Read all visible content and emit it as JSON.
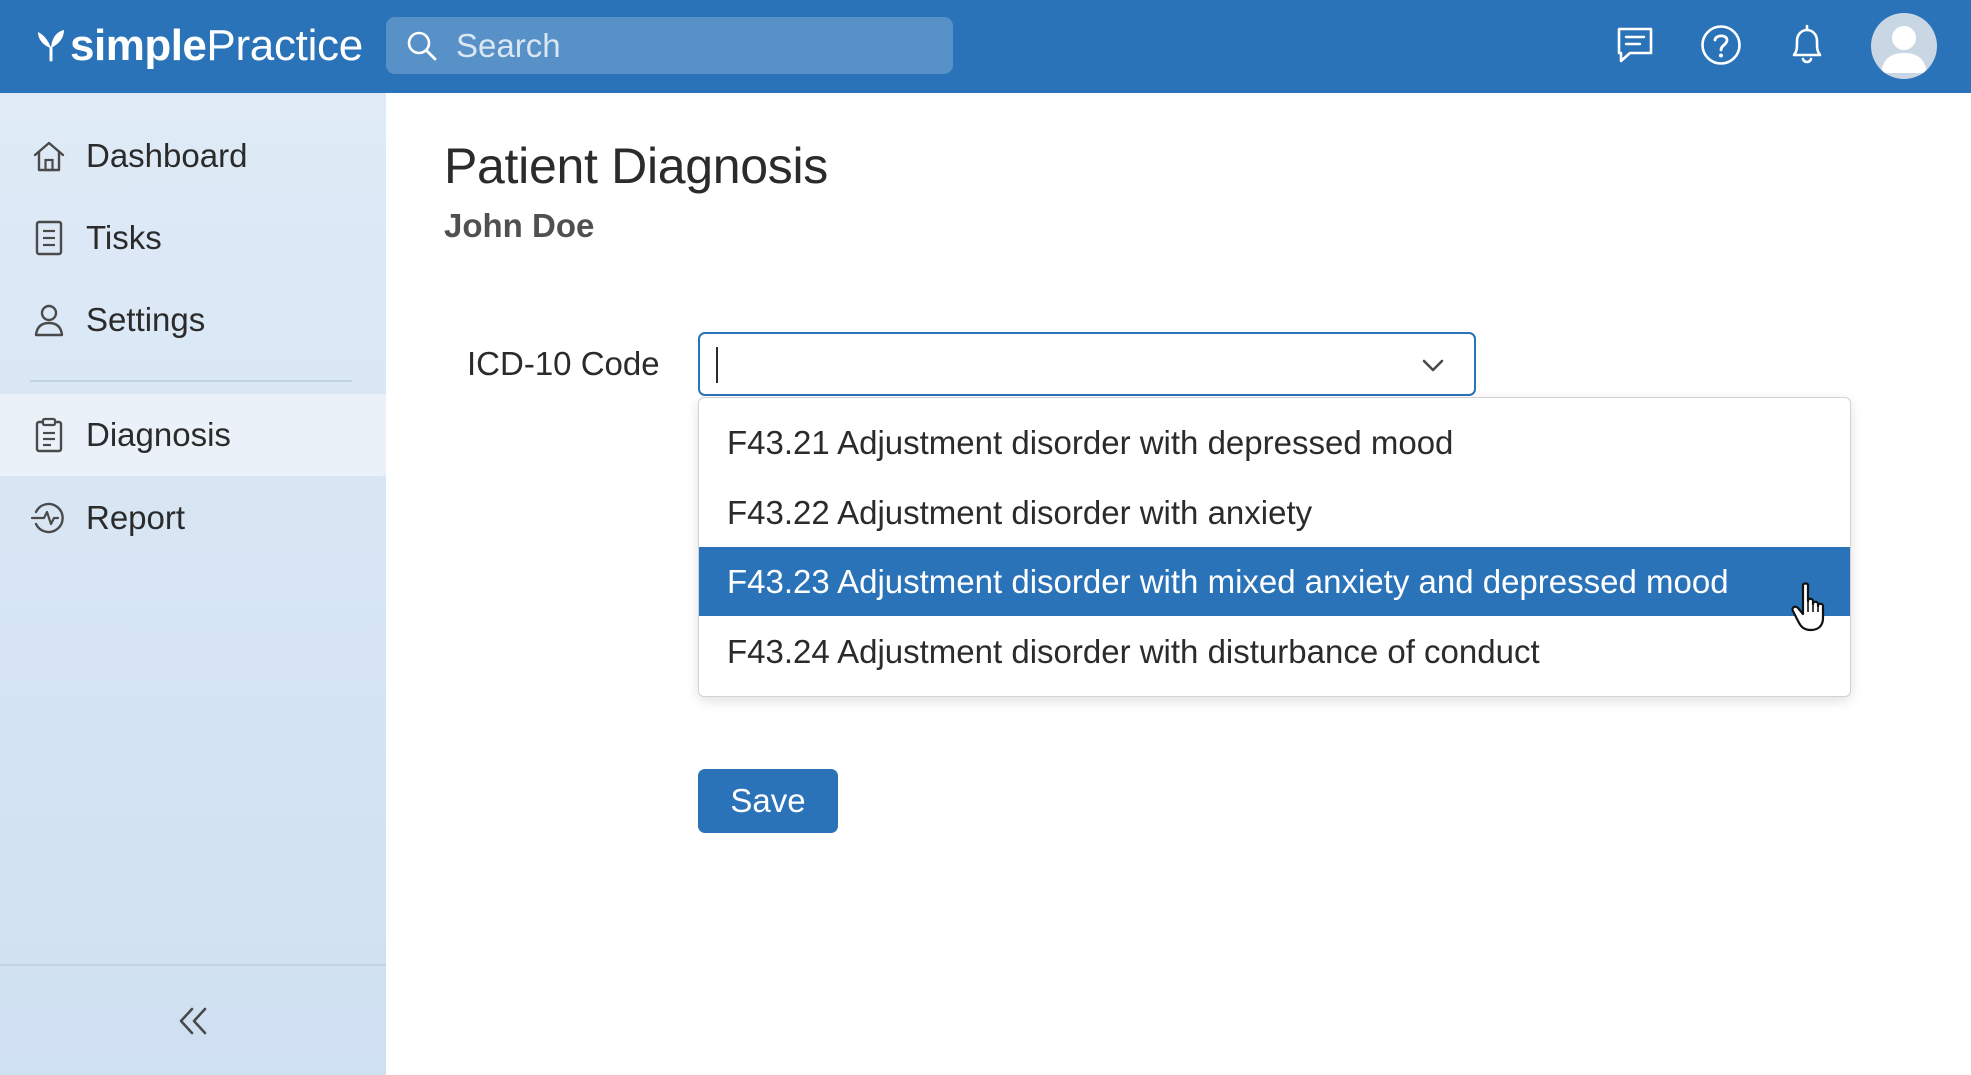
{
  "brand": {
    "name_bold": "simple",
    "name_regular": "Practice"
  },
  "header": {
    "search": {
      "placeholder": "Search",
      "value": ""
    },
    "icons": [
      "chat-icon",
      "help-icon",
      "bell-icon",
      "avatar"
    ]
  },
  "sidebar": {
    "items": [
      {
        "label": "Dashboard",
        "icon": "home-icon",
        "active": false
      },
      {
        "label": "Tisks",
        "icon": "task-list-icon",
        "active": false
      },
      {
        "label": "Settings",
        "icon": "person-icon",
        "active": false
      },
      {
        "label": "Diagnosis",
        "icon": "clipboard-icon",
        "active": true
      },
      {
        "label": "Report",
        "icon": "report-icon",
        "active": false
      }
    ],
    "collapse_icon": "double-chevron-left-icon"
  },
  "main": {
    "title": "Patient Diagnosis",
    "patient_name": "John Doe",
    "icd_field": {
      "label": "ICD-10 Code",
      "value": "",
      "options": [
        "F43.21 Adjustment disorder with depressed mood",
        "F43.22 Adjustment disorder with anxiety",
        "F43.23 Adjustment disorder with mixed anxiety and depressed mood",
        "F43.24 Adjustment disorder with disturbance of conduct"
      ],
      "highlighted_index": 2
    },
    "save_label": "Save"
  },
  "colors": {
    "primary": "#2a73b8",
    "sidebar_bg": "#dfeaf6",
    "sidebar_active": "#eaf1f8",
    "text": "#2b2b2b"
  }
}
